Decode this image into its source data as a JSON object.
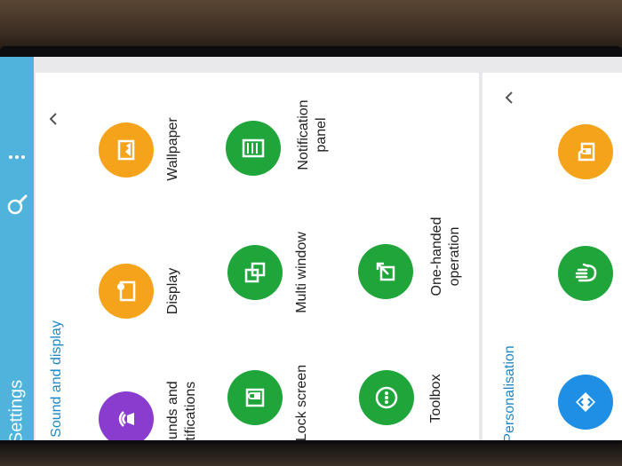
{
  "header": {
    "title": "Settings"
  },
  "sound_and_display": {
    "title": "Sound and display",
    "items": [
      {
        "label": "Sounds and\nnotifications",
        "icon": "speaker-icon",
        "color": "#8a3ccf"
      },
      {
        "label": "Display",
        "icon": "display-icon",
        "color": "#f5a31a"
      },
      {
        "label": "Wallpaper",
        "icon": "wallpaper-icon",
        "color": "#f5a31a"
      },
      {
        "label": "Lock screen",
        "icon": "lock-screen-icon",
        "color": "#1fa53a"
      },
      {
        "label": "Multi window",
        "icon": "multi-window-icon",
        "color": "#1fa53a"
      },
      {
        "label": "Notification\npanel",
        "icon": "notification-panel-icon",
        "color": "#1fa53a"
      },
      {
        "label": "Toolbox",
        "icon": "toolbox-icon",
        "color": "#1fa53a"
      },
      {
        "label": "One-handed\noperation",
        "icon": "one-handed-icon",
        "color": "#1fa53a"
      }
    ]
  },
  "personalisation": {
    "title": "Personalisation",
    "items": [
      {
        "icon": "easy-mode-icon",
        "color": "#1f8fe6"
      },
      {
        "icon": "hand-icon",
        "color": "#1fa53a"
      },
      {
        "icon": "private-mode-icon",
        "color": "#f5a31a"
      }
    ]
  },
  "colors": {
    "accent": "#4fb3dc",
    "section_title": "#1e88c6"
  }
}
